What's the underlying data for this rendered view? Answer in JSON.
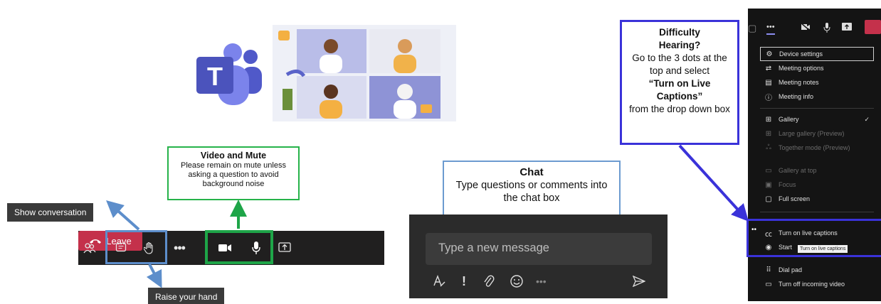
{
  "callouts": {
    "video_mute": {
      "title": "Video and Mute",
      "body": "Please remain on mute unless asking a question to avoid background noise"
    },
    "chat": {
      "title": "Chat",
      "body": "Type questions or comments into the chat box"
    },
    "hearing": {
      "line1": "Difficulty",
      "line2": "Hearing?",
      "line3": "Go to the 3 dots at the top and select",
      "line4": "“Turn on Live Captions”",
      "line5": "from the drop down box"
    }
  },
  "tooltips": {
    "show_conversation": "Show conversation",
    "raise_hand": "Raise your hand"
  },
  "toolbar": {
    "more": "•••",
    "leave_label": "Leave"
  },
  "chat_panel": {
    "placeholder": "Type a new message",
    "tools": [
      "format-icon",
      "important-icon",
      "attach-icon",
      "emoji-icon",
      "more-icon",
      "send-icon"
    ]
  },
  "menu": {
    "items": [
      {
        "label": "Device settings",
        "icon": "gear-icon",
        "enabled": true
      },
      {
        "label": "Meeting options",
        "icon": "sliders-icon",
        "enabled": true
      },
      {
        "label": "Meeting notes",
        "icon": "notes-icon",
        "enabled": true
      },
      {
        "label": "Meeting info",
        "icon": "info-icon",
        "enabled": true
      },
      {
        "label": "Gallery",
        "icon": "grid-icon",
        "enabled": true
      },
      {
        "label": "Large gallery (Preview)",
        "icon": "grid-icon",
        "enabled": false
      },
      {
        "label": "Together mode (Preview)",
        "icon": "people-icon",
        "enabled": false
      },
      {
        "label": "Gallery at top",
        "icon": "layout-icon",
        "enabled": false
      },
      {
        "label": "Focus",
        "icon": "focus-icon",
        "enabled": false
      },
      {
        "label": "Full screen",
        "icon": "fullscreen-icon",
        "enabled": true
      },
      {
        "label": "Turn on live captions",
        "icon": "cc-icon",
        "enabled": true
      },
      {
        "label": "Start",
        "icon": "record-icon",
        "enabled": true
      },
      {
        "label": "Dial pad",
        "icon": "dialpad-icon",
        "enabled": true
      },
      {
        "label": "Turn off incoming video",
        "icon": "video-off-icon",
        "enabled": true
      }
    ],
    "tooltip": "Turn on live captions",
    "top_more": "•••"
  },
  "colors": {
    "blue_highlight": "#5d8ecb",
    "green_highlight": "#1ea548",
    "purple_highlight": "#3a32d9",
    "leave_red": "#c4314b",
    "teams_purple": "#5059c9"
  }
}
